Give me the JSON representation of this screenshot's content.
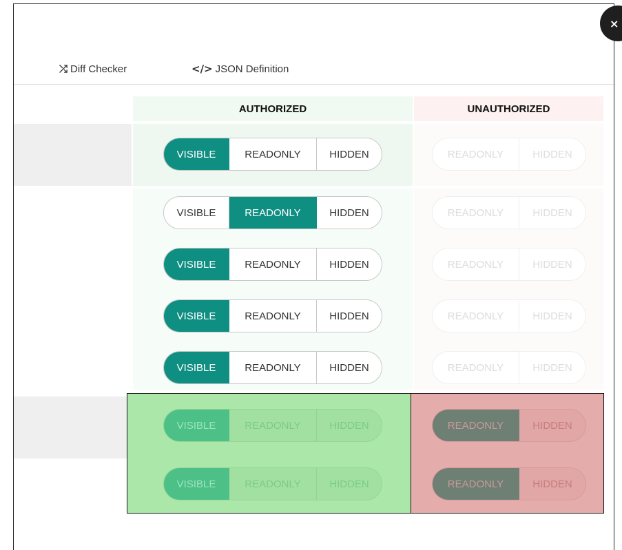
{
  "tabs": [
    {
      "icon": "shuffle-icon",
      "glyph": "⤮",
      "label": "Diff Checker"
    },
    {
      "icon": "code-icon",
      "glyph": "</>",
      "label": "JSON Definition"
    }
  ],
  "close": {
    "glyph": "×"
  },
  "columns": {
    "authorized": "AUTHORIZED",
    "unauthorized": "UNAUTHORIZED"
  },
  "options": {
    "visible": "VISIBLE",
    "readonly": "READONLY",
    "hidden": "HIDDEN"
  },
  "rows": [
    {
      "authorized_selected": "VISIBLE",
      "unauthorized_selected": null,
      "unauthorized_disabled": true
    },
    {
      "authorized_selected": "READONLY",
      "unauthorized_selected": null,
      "unauthorized_disabled": true
    },
    {
      "authorized_selected": "VISIBLE",
      "unauthorized_selected": null,
      "unauthorized_disabled": true
    },
    {
      "authorized_selected": "VISIBLE",
      "unauthorized_selected": null,
      "unauthorized_disabled": true
    },
    {
      "authorized_selected": "VISIBLE",
      "unauthorized_selected": null,
      "unauthorized_disabled": true
    },
    {
      "authorized_selected": "VISIBLE",
      "unauthorized_selected": "READONLY",
      "unauthorized_disabled": false
    },
    {
      "authorized_selected": "VISIBLE",
      "unauthorized_selected": "READONLY",
      "unauthorized_disabled": false
    }
  ],
  "colors": {
    "active": "#0f8e82",
    "highlight_green": "#abe7a8",
    "highlight_red": "#e5acac"
  }
}
